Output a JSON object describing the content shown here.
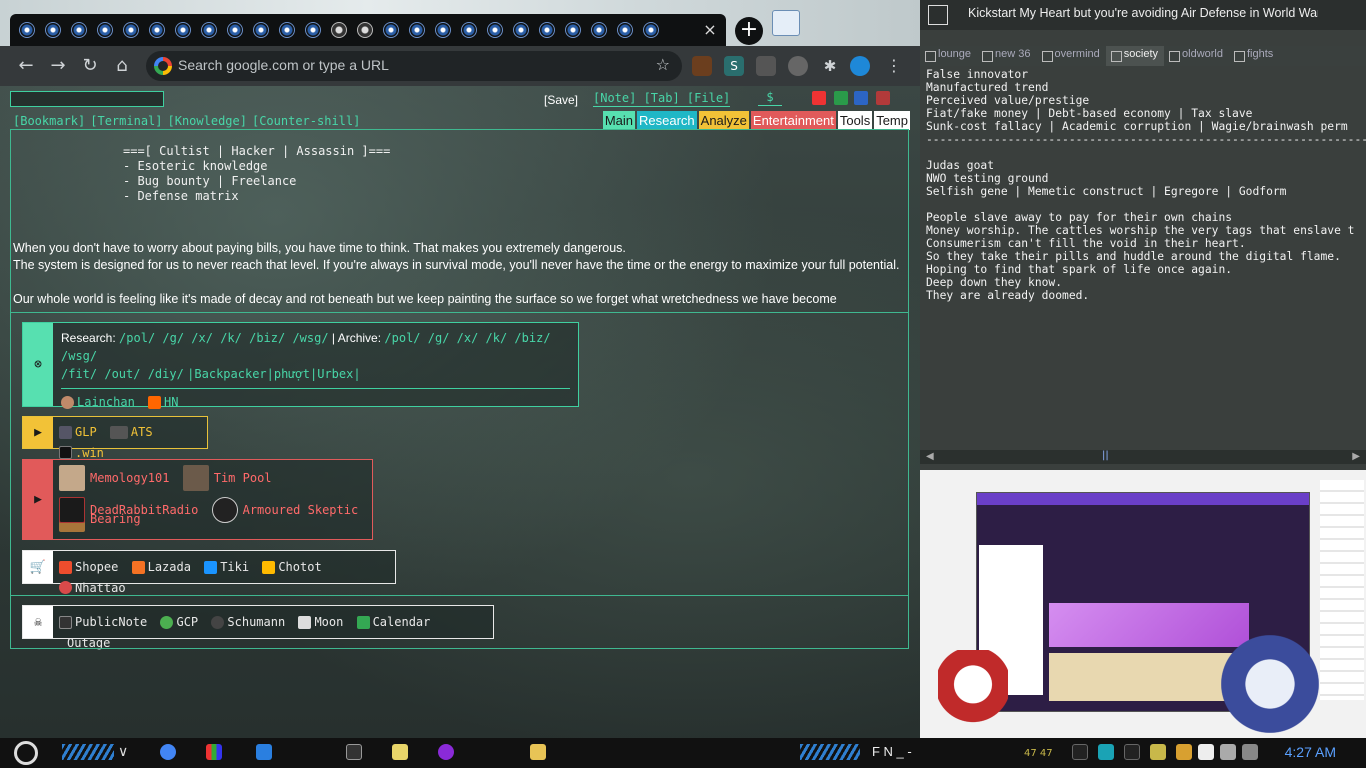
{
  "browser": {
    "omnibox_placeholder": "Search google.com or type a URL",
    "close_tab": "×",
    "new_tab": "+"
  },
  "startpage": {
    "quick_links": [
      "[Bookmark]",
      "[Terminal]",
      "[Knowledge]",
      "[Counter-shill]"
    ],
    "save": "[Save]",
    "note_links": "[Note] [Tab] [File]",
    "dollar": "$",
    "categories": [
      {
        "label": "Main",
        "bg": "#57e0b0",
        "fg": "#1a1a1a"
      },
      {
        "label": "Research",
        "bg": "#1fb7c6",
        "fg": "#ffffff"
      },
      {
        "label": "Analyze",
        "bg": "#f2c237",
        "fg": "#1a1a1a"
      },
      {
        "label": "Entertainment",
        "bg": "#e15a5a",
        "fg": "#ffffff"
      },
      {
        "label": "Tools",
        "bg": "#ffffff",
        "fg": "#1a1a1a"
      },
      {
        "label": "Temp",
        "bg": "#ffffff",
        "fg": "#1a1a1a"
      }
    ],
    "motto": "===[ Cultist | Hacker | Assassin ]===\n- Esoteric knowledge\n- Bug bounty | Freelance\n- Defense matrix",
    "quote_1": "When you don't have to worry about paying bills, you have time to think. That makes you extremely dangerous.",
    "quote_2": "The system is designed for us to never reach that level. If you're always in survival mode, you'll never have the time or the energy to maximize your full potential.",
    "quote_3": "Our whole world is feeling like it's made of decay and rot beneath but we keep painting the surface so we forget what wretchedness we have become",
    "research": {
      "research_label": "Research:",
      "research_links": "/pol/ /g/ /x/ /k/ /biz/ /wsg/",
      "archive_label": "| Archive:",
      "archive_links_1": "/pol/ /g/ /x/ /k/ /biz/ /wsg/",
      "archive_links_2": "/fit/ /out/ /diy/",
      "sites": "|Backpacker|phượt|Urbex|",
      "chips": [
        "Lainchan",
        "HN"
      ]
    },
    "analyze_chips": [
      "GLP",
      "ATS",
      ".win"
    ],
    "entertainment_row1": [
      "Memology101",
      "Tim Pool",
      "Bearing"
    ],
    "entertainment_row2": [
      "DeadRabbitRadio",
      "Armoured Skeptic"
    ],
    "shops": [
      "Shopee",
      "Lazada",
      "Tiki",
      "Chotot",
      "Nhattao"
    ],
    "tools": [
      "PublicNote",
      "GCP",
      "Schumann",
      "Moon",
      "Calendar",
      "Outage"
    ]
  },
  "notes": {
    "title": "Kickstart My Heart but you're avoiding Air Defense in World War...",
    "tabs": [
      "lounge",
      "new 36",
      "overmind",
      "society",
      "oldworld",
      "fights"
    ],
    "active_tab": "society",
    "body": "False innovator\nManufactured trend\nPerceived value/prestige\nFiat/fake money | Debt-based economy | Tax slave\nSunk-cost fallacy | Academic corruption | Wagie/brainwash perm\n-----------------------------------------------------------------\n\nJudas goat\nNWO testing ground\nSelfish gene | Memetic construct | Egregore | Godform\n\nPeople slave away to pay for their own chains\nMoney worship. The cattles worship the very tags that enslave t\nConsumerism can't fill the void in their heart.\nSo they take their pills and huddle around the digital flame.\nHoping to find that spark of life once again.\nDeep down they know.\nThey are already doomed.",
    "scroll_mid": "||"
  },
  "taskbar": {
    "tray_letters": "F    N  _  -",
    "tray_nums": "47    47",
    "clock": "4:27 AM"
  }
}
